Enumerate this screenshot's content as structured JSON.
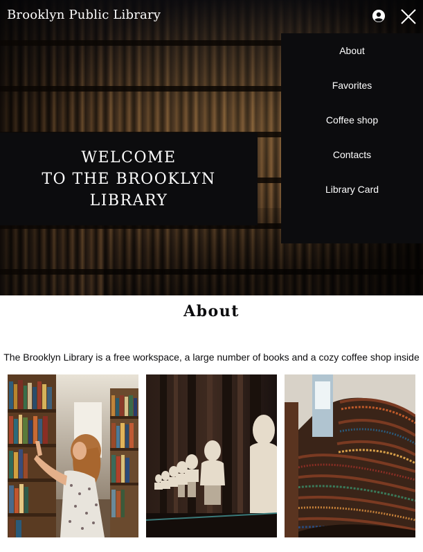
{
  "header": {
    "logo": "Brooklyn Public Library",
    "icons": {
      "profile": "user-circle-icon",
      "close": "close-icon"
    }
  },
  "menu": {
    "items": [
      {
        "label": "About"
      },
      {
        "label": "Favorites"
      },
      {
        "label": "Coffee shop"
      },
      {
        "label": "Contacts"
      },
      {
        "label": "Library Card"
      }
    ]
  },
  "hero": {
    "welcome_lines": [
      "WELCOME",
      "TO THE BROOKLYN",
      "LIBRARY"
    ]
  },
  "about": {
    "title": "About",
    "text": "The Brooklyn Library is a free workspace, a large number of books and a cozy coffee shop inside",
    "photos": [
      "woman-browsing-bookshelf-photo",
      "marble-busts-hall-photo",
      "curved-bookshelves-photo"
    ]
  },
  "colors": {
    "dark": "#0c0c0e",
    "text_light": "#ffffff",
    "background": "#ffffff"
  }
}
